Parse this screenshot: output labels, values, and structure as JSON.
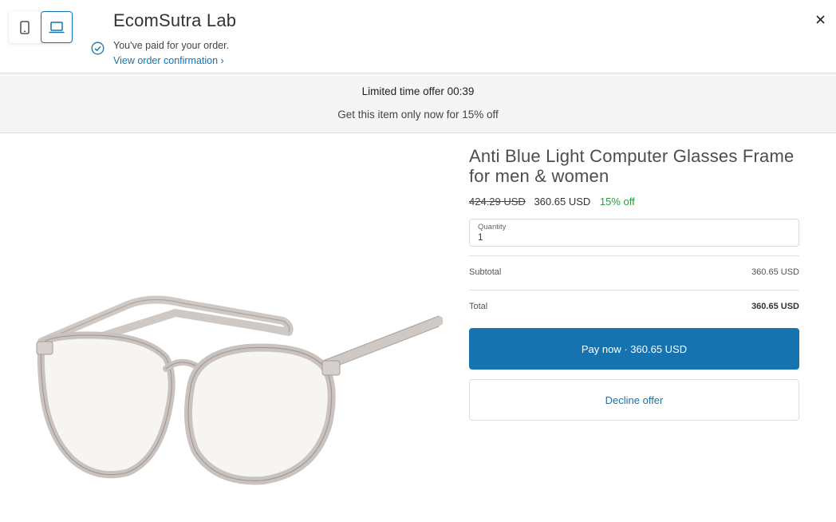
{
  "header": {
    "store_name": "EcomSutra Lab",
    "paid_message": "You've paid for your order.",
    "confirmation_link": "View order confirmation ›",
    "view_toggle": {
      "mobile_icon": "mobile-icon",
      "desktop_icon": "desktop-icon",
      "selected": "desktop"
    },
    "close_icon": "close-icon"
  },
  "banner": {
    "title": "Limited time offer 00:39",
    "subtitle": "Get this item only now for 15% off"
  },
  "product": {
    "title": "Anti Blue Light Computer Glasses Frame for men & women",
    "original_price": "424.29 USD",
    "sale_price": "360.65 USD",
    "discount": "15% off",
    "image": "clear-frame-eyeglasses"
  },
  "quantity": {
    "label": "Quantity",
    "value": "1"
  },
  "summary": {
    "subtotal_label": "Subtotal",
    "subtotal_value": "360.65 USD",
    "total_label": "Total",
    "total_value": "360.65 USD"
  },
  "actions": {
    "pay_label": "Pay now · 360.65 USD",
    "decline_label": "Decline offer"
  },
  "colors": {
    "accent": "#1773b0",
    "discount": "#2a9d3e",
    "banner_bg": "#f5f5f5"
  }
}
